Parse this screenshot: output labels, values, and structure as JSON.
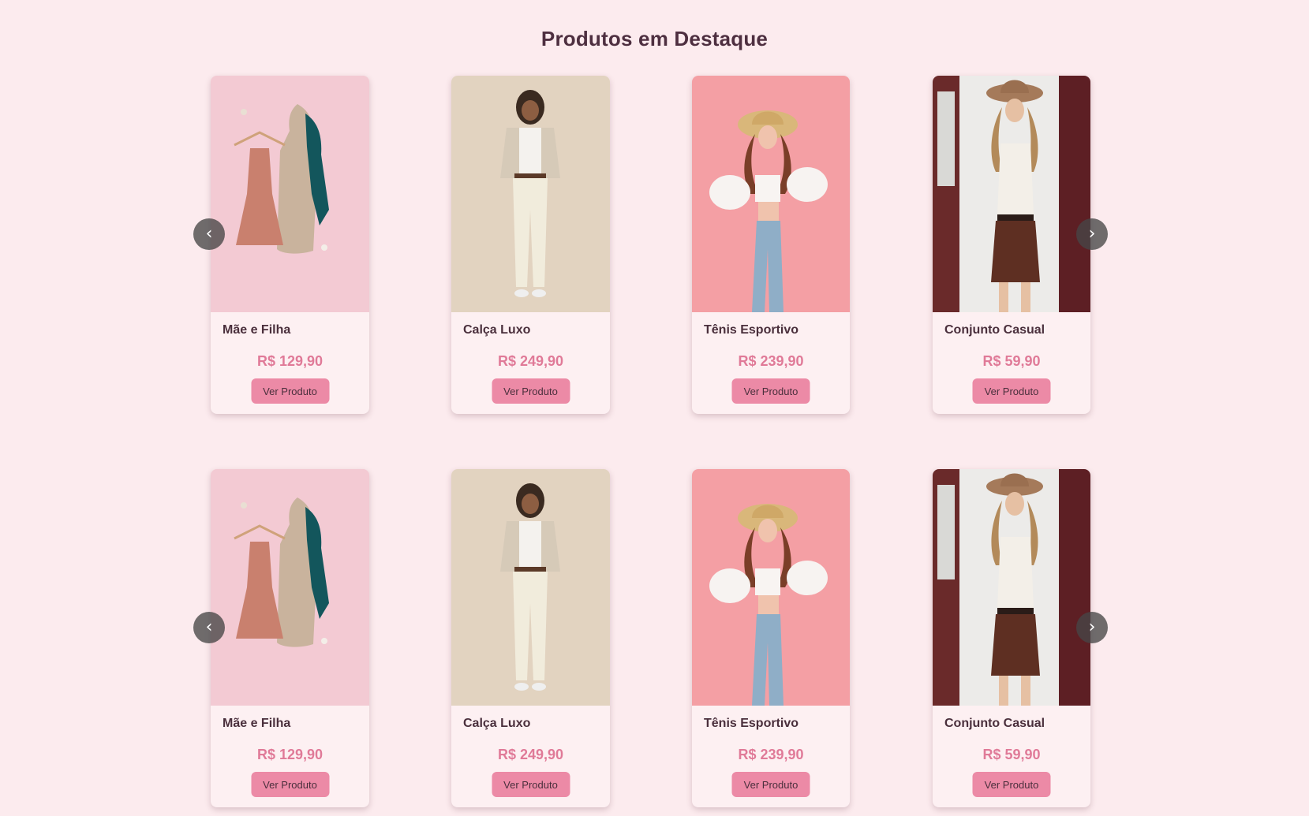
{
  "section": {
    "title": "Produtos em Destaque"
  },
  "carousels": [
    {
      "prev_icon": "‹",
      "next_icon": "›",
      "products": [
        {
          "name": "Mãe e Filha",
          "price": "R$ 129,90",
          "button_label": "Ver Produto"
        },
        {
          "name": "Calça Luxo",
          "price": "R$ 249,90",
          "button_label": "Ver Produto"
        },
        {
          "name": "Tênis Esportivo",
          "price": "R$ 239,90",
          "button_label": "Ver Produto"
        },
        {
          "name": "Conjunto Casual",
          "price": "R$ 59,90",
          "button_label": "Ver Produto"
        }
      ]
    },
    {
      "prev_icon": "‹",
      "next_icon": "›",
      "products": [
        {
          "name": "Mãe e Filha",
          "price": "R$ 129,90",
          "button_label": "Ver Produto"
        },
        {
          "name": "Calça Luxo",
          "price": "R$ 249,90",
          "button_label": "Ver Produto"
        },
        {
          "name": "Tênis Esportivo",
          "price": "R$ 239,90",
          "button_label": "Ver Produto"
        },
        {
          "name": "Conjunto Casual",
          "price": "R$ 59,90",
          "button_label": "Ver Produto"
        }
      ]
    }
  ],
  "colors": {
    "page_background": "#fcebee",
    "card_background": "#fdf0f2",
    "price": "#e07a98",
    "button": "#ec8aa6",
    "title": "#4e2f40",
    "arrow": "#464646"
  }
}
